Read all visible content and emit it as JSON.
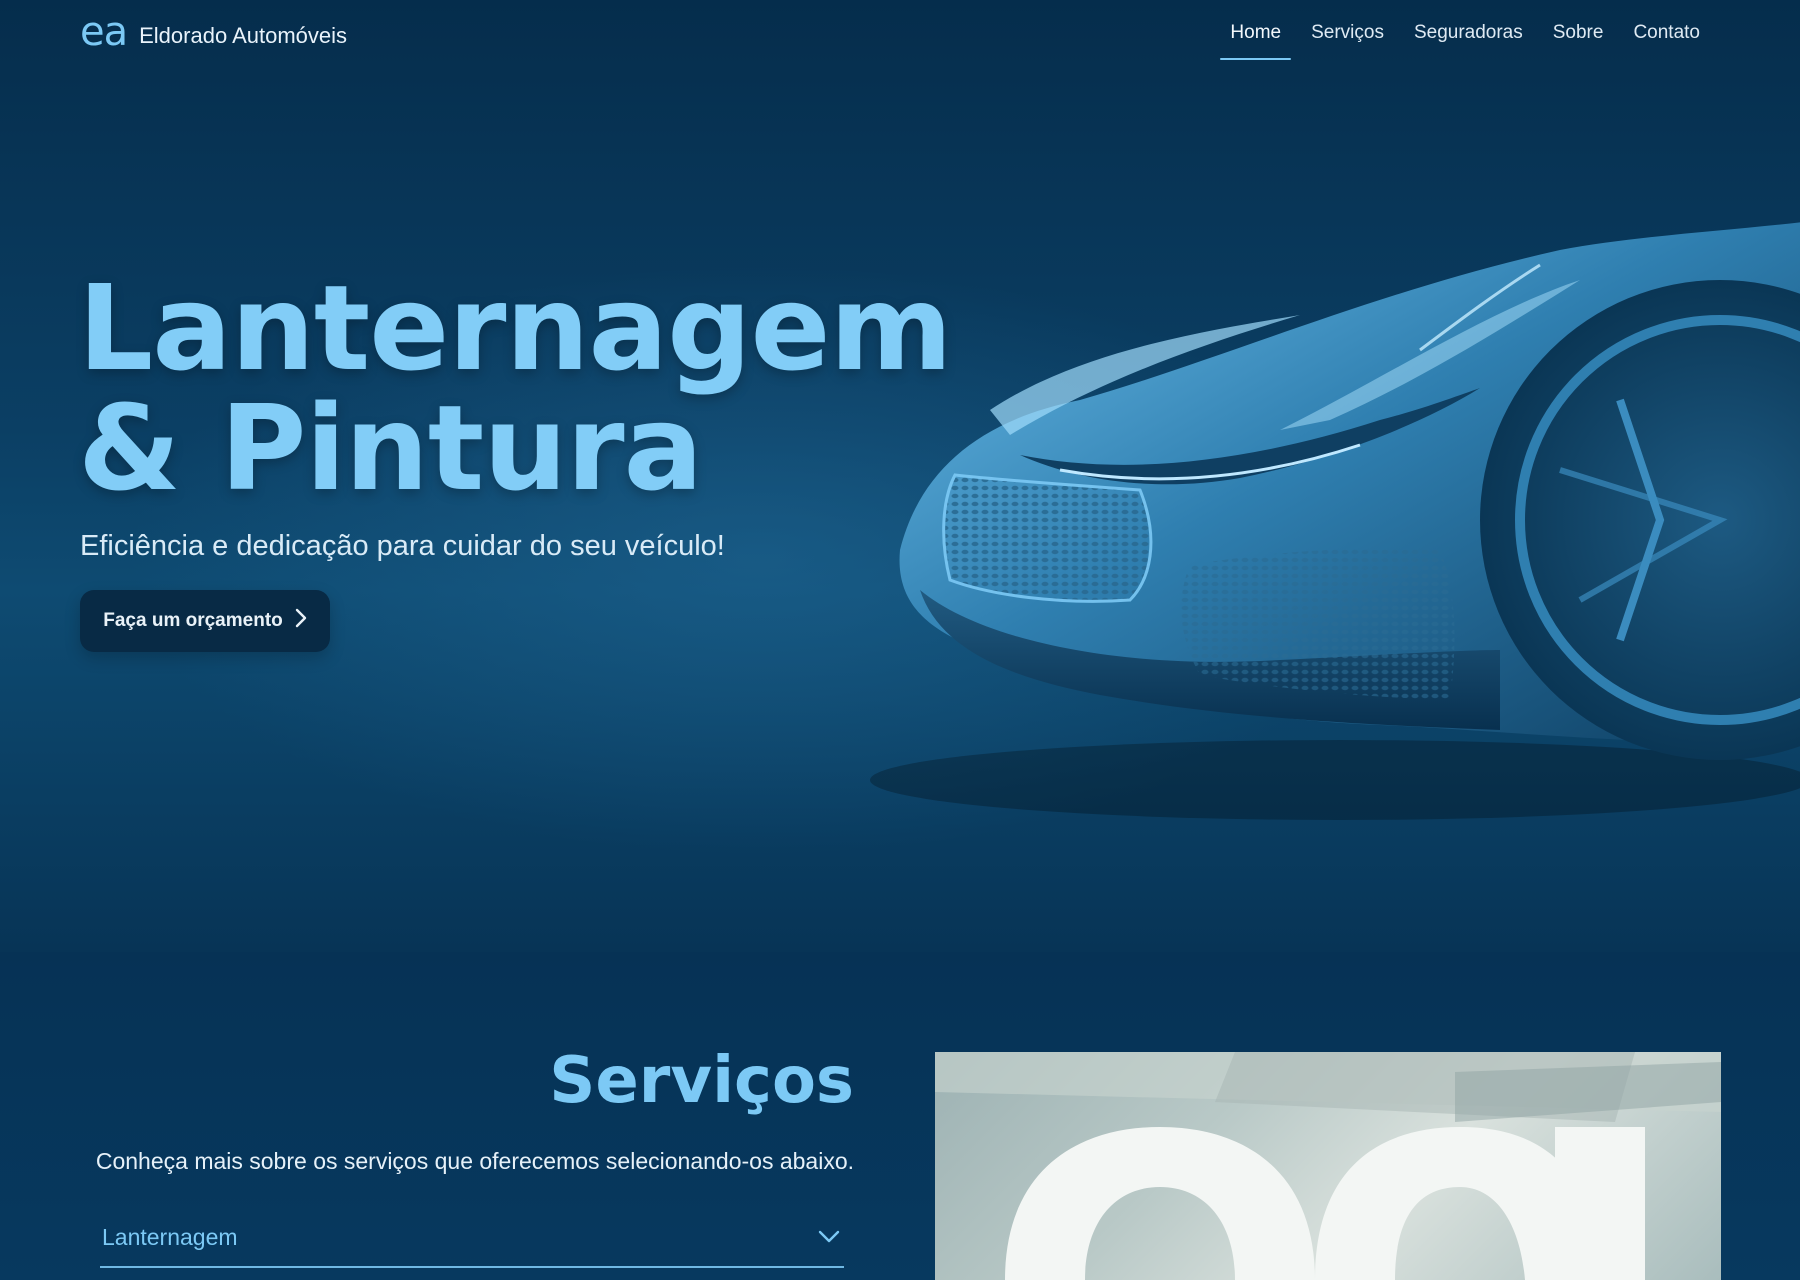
{
  "header": {
    "logo_mark": "ea",
    "brand_name": "Eldorado Automóveis",
    "nav": [
      {
        "label": "Home",
        "active": true
      },
      {
        "label": "Serviços",
        "active": false
      },
      {
        "label": "Seguradoras",
        "active": false
      },
      {
        "label": "Sobre",
        "active": false
      },
      {
        "label": "Contato",
        "active": false
      }
    ]
  },
  "hero": {
    "title_line1": "Lanternagem",
    "title_line2": "& Pintura",
    "subtitle": "Eficiência e dedicação para cuidar do seu veículo!",
    "cta_label": "Faça um orçamento",
    "cta_icon": "chevron-right-icon",
    "image": "sports-car-front"
  },
  "services": {
    "title": "Serviços",
    "description": "Conheça mais sobre os serviços que oferecemos selecionando-os abaixo.",
    "accordion": {
      "selected": "Lanternagem",
      "icon": "chevron-down-icon"
    },
    "image": "ea-logo-in-workshop"
  },
  "colors": {
    "accent": "#7cc9f5",
    "background": "#06385c",
    "button": "#082a45",
    "text": "#e6f1f9"
  }
}
